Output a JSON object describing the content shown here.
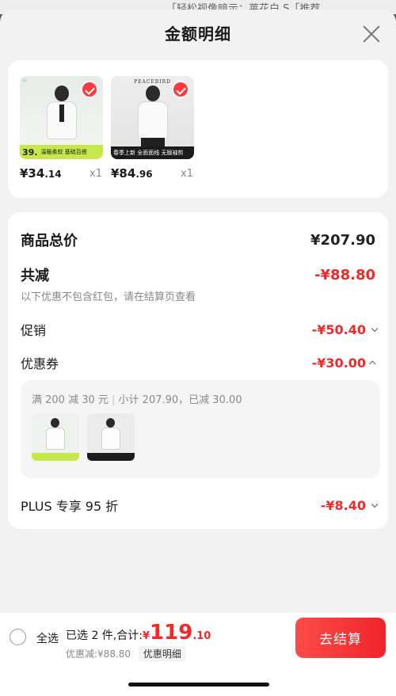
{
  "background_peek": "「轻松视像暗示：莱花白  S「推荐",
  "sheet": {
    "title": "金额明细"
  },
  "products": [
    {
      "price_main": "¥34",
      "price_cents": ".14",
      "qty": "x1",
      "band_price": "39.",
      "band_text": "温暖柔软 基础百搭",
      "brand": ""
    },
    {
      "price_main": "¥84",
      "price_cents": ".96",
      "qty": "x1",
      "band_price": "",
      "band_text": "春季上新  全面面线  无版袖剪",
      "brand": "PEACEBIRD"
    }
  ],
  "details": {
    "total_label": "商品总价",
    "total_value": "¥207.90",
    "cut_label": "共减",
    "cut_value": "-¥88.80",
    "cut_note": "以下优惠不包含红包，请在结算页查看",
    "promo_label": "促销",
    "promo_value": "-¥50.40",
    "coupon_label": "优惠券",
    "coupon_value": "-¥30.00",
    "coupon_rule": "满 200 减 30 元",
    "coupon_subtotal": "小计 207.90，已减 30.00",
    "plus_label": "PLUS 专享 95 折",
    "plus_value": "-¥8.40"
  },
  "bottom": {
    "select_all": "全选",
    "selected_text": "已选 2 件,合计:",
    "total_yen": "¥",
    "total_int": "119",
    "total_dec": ".10",
    "discount_text": "优惠减:¥88.80",
    "detail_chip": "优惠明细",
    "checkout": "去结算"
  },
  "colors": {
    "accent_red": "#f02a2a",
    "product_band_green": "#c6e84a"
  }
}
